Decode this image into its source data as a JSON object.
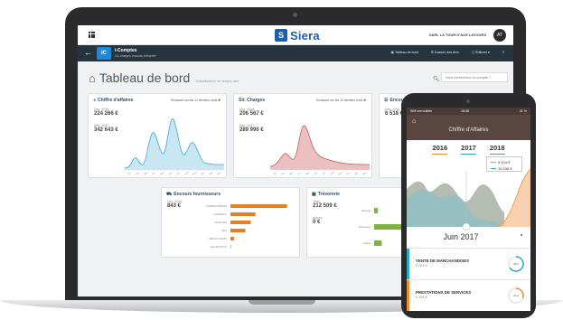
{
  "header": {
    "logo_mark": "S",
    "logo_text": "Siera",
    "company": "SARL LA TOUR D'AUX LAYOURS",
    "avatar_initials": "AT"
  },
  "nav": {
    "app_badge": "iC",
    "app_name": "i-Comptes",
    "app_sub": "CA, charges, encours, trésorerie",
    "links": [
      "Tableau de bord",
      "Dossier des tiers",
      "Éditions ▾"
    ],
    "help": "?"
  },
  "page": {
    "title": "Tableau de bord",
    "subtitle": "Actualisation en temps réel",
    "search_placeholder": "Vous recherchez un compte ?"
  },
  "cards": {
    "ca": {
      "title": "Chiffre d'affaires",
      "period": "Tendance sur les 12 derniers mois",
      "l1": "Déc. 2018",
      "v1": "224 266 €",
      "l2": "Déc. 2017",
      "v2": "342 643 €"
    },
    "charges": {
      "title": "Sit. Charges",
      "period": "Tendance sur les 12 derniers mois",
      "l1": "Déc. 2018",
      "v1": "206 567 €",
      "l2": "Déc. 2017",
      "v2": "289 990 €"
    },
    "encours_clients": {
      "title": "Encours clients",
      "l1": "Déc. 2018",
      "v1": "6 518 €"
    },
    "encours_fournisseurs": {
      "title": "Encours fournisseurs",
      "l1": "Déc. 2018",
      "v1": "843 €",
      "bars": [
        {
          "label": "HOBBIES BAZAR",
          "value": 0.95
        },
        {
          "label": "LUMINEUX",
          "value": 0.42
        },
        {
          "label": "ZOOLAND",
          "value": 0.34
        },
        {
          "label": "SEO",
          "value": 0.25
        },
        {
          "label": "REGUL ACHAT",
          "value": 0.06
        },
        {
          "label": "ACHATS DIVS",
          "value": 0.0
        }
      ]
    },
    "tresorerie": {
      "title": "Trésorerie",
      "l1": "Total",
      "v1": "212 509 €",
      "l2": "Autres",
      "v2": "0 €",
      "bars": [
        {
          "label": "Banque",
          "value": 0.03
        },
        {
          "label": "Placement",
          "value": 1.0
        },
        {
          "label": "Caisse",
          "value": 0.06
        }
      ]
    }
  },
  "phone": {
    "status_left": "SIM verrouillée",
    "status_time": "16:38",
    "status_right": "41 %",
    "title": "Chiffre d'Affaires",
    "years": [
      "2016",
      "2017",
      "2018"
    ],
    "legend": [
      {
        "value": "9 204 €",
        "color": "#f28b30"
      },
      {
        "value": "15 538 €",
        "color": "#2aa9c8"
      }
    ],
    "month": "Juin 2017",
    "items": [
      {
        "label": "VENTE DE MARCHANDISES",
        "value": "9 204 €",
        "color": "#2aa9c8",
        "pct": "59%"
      },
      {
        "label": "PRESTATIONS DE SERVICES",
        "value": "6 334 €",
        "color": "#f28b30",
        "pct": "41%"
      }
    ]
  },
  "chart_ticks": [
    "Jan",
    "Fév",
    "Mar",
    "Avr",
    "Mai",
    "Juin",
    "Juil",
    "Août",
    "Sep",
    "Oct",
    "Nov",
    "Déc"
  ]
}
